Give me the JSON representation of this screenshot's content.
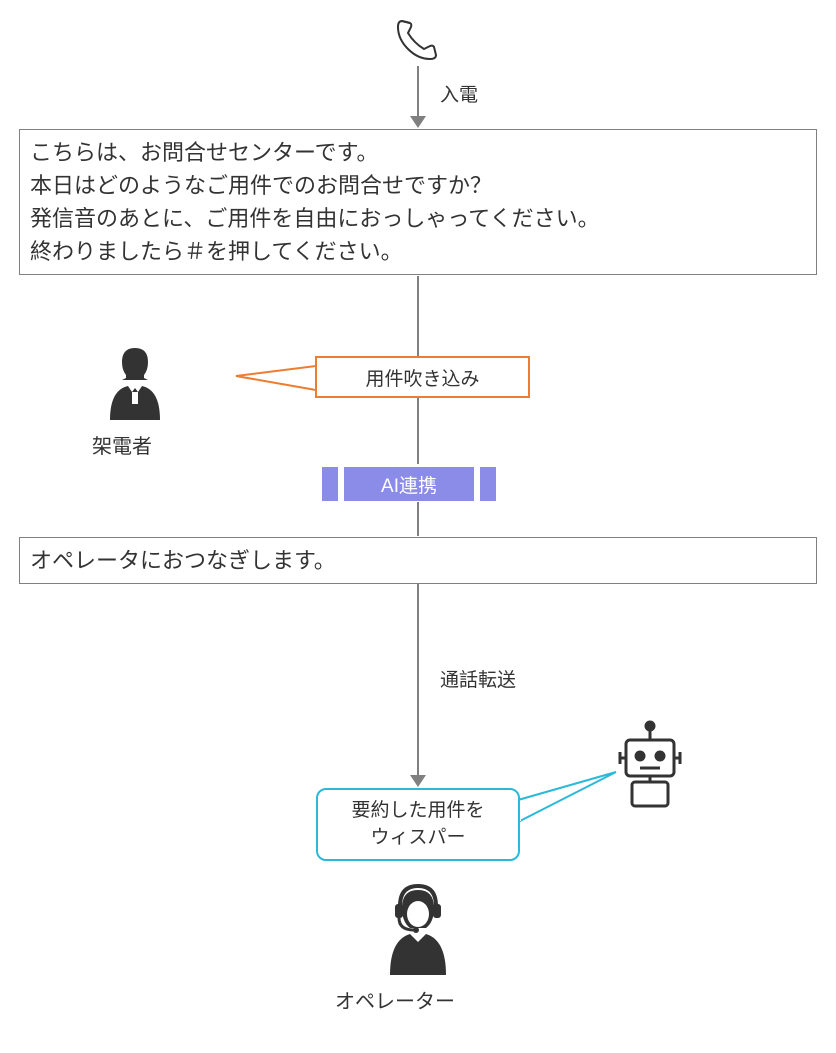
{
  "labels": {
    "incoming": "入電",
    "caller": "架電者",
    "transfer": "通話転送",
    "operator": "オペレーター"
  },
  "box1": {
    "line1": "こちらは、お問合せセンターです。",
    "line2": "本日はどのようなご用件でのお問合せですか？",
    "line3": "発信音のあとに、ご用件を自由におっしゃってください。",
    "line4": "終わりましたら＃を押してください。"
  },
  "callout1": "用件吹き込み",
  "ai": "AI連携",
  "box2": "オペレータにおつなぎします。",
  "callout2": {
    "line1": "要約した用件を",
    "line2": "ウィスパー"
  }
}
